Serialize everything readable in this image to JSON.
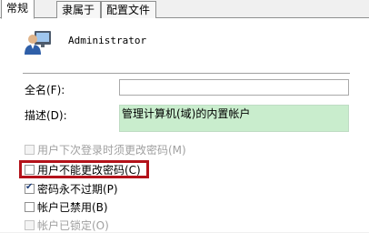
{
  "tabs": [
    {
      "label": "常规",
      "active": true
    },
    {
      "label": "隶属于",
      "active": false
    },
    {
      "label": "配置文件",
      "active": false
    }
  ],
  "user": {
    "icon": "user-account-icon",
    "name": "Administrator"
  },
  "fields": {
    "fullname_label": "全名(F):",
    "fullname_value": "",
    "description_label": "描述(D):",
    "description_value": "管理计算机(域)的内置帐户"
  },
  "checkboxes": [
    {
      "label": "用户下次登录时须更改密码(M)",
      "checked": false,
      "disabled": true
    },
    {
      "label": "用户不能更改密码(C)",
      "checked": false,
      "disabled": false
    },
    {
      "label": "密码永不过期(P)",
      "checked": true,
      "disabled": false
    },
    {
      "label": "帐户已禁用(B)",
      "checked": false,
      "disabled": false
    },
    {
      "label": "帐户已锁定(O)",
      "checked": false,
      "disabled": true
    }
  ],
  "colors": {
    "highlight": "#b3121a",
    "description_bg": "#c9edcd"
  }
}
